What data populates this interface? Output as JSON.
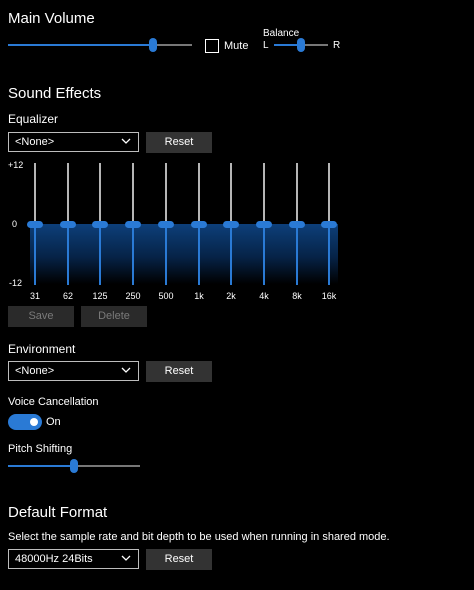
{
  "main_volume": {
    "title": "Main Volume",
    "level": 0.79,
    "mute_label": "Mute",
    "mute_checked": false,
    "balance_label": "Balance",
    "balance_left": "L",
    "balance_right": "R",
    "balance_level": 0.5
  },
  "sound_effects": {
    "title": "Sound Effects",
    "equalizer_label": "Equalizer",
    "equalizer_preset": "<None>",
    "reset_label": "Reset",
    "db_top": "+12",
    "db_mid": "0",
    "db_bottom": "-12",
    "bands": [
      {
        "freq": "31",
        "gain_db": 0
      },
      {
        "freq": "62",
        "gain_db": 0
      },
      {
        "freq": "125",
        "gain_db": 0
      },
      {
        "freq": "250",
        "gain_db": 0
      },
      {
        "freq": "500",
        "gain_db": 0
      },
      {
        "freq": "1k",
        "gain_db": 0
      },
      {
        "freq": "2k",
        "gain_db": 0
      },
      {
        "freq": "4k",
        "gain_db": 0
      },
      {
        "freq": "8k",
        "gain_db": 0
      },
      {
        "freq": "16k",
        "gain_db": 0
      }
    ],
    "save_label": "Save",
    "delete_label": "Delete",
    "environment_label": "Environment",
    "environment_preset": "<None>",
    "environment_reset_label": "Reset",
    "voice_cancellation_label": "Voice Cancellation",
    "voice_cancellation_state": "On",
    "pitch_shifting_label": "Pitch Shifting",
    "pitch_level": 0.5
  },
  "default_format": {
    "title": "Default Format",
    "description": "Select the sample rate and bit depth to be used when running in shared mode.",
    "format_value": "48000Hz 24Bits",
    "reset_label": "Reset"
  },
  "colors": {
    "accent": "#2a7ad5",
    "background": "#000000",
    "button": "#333333"
  }
}
